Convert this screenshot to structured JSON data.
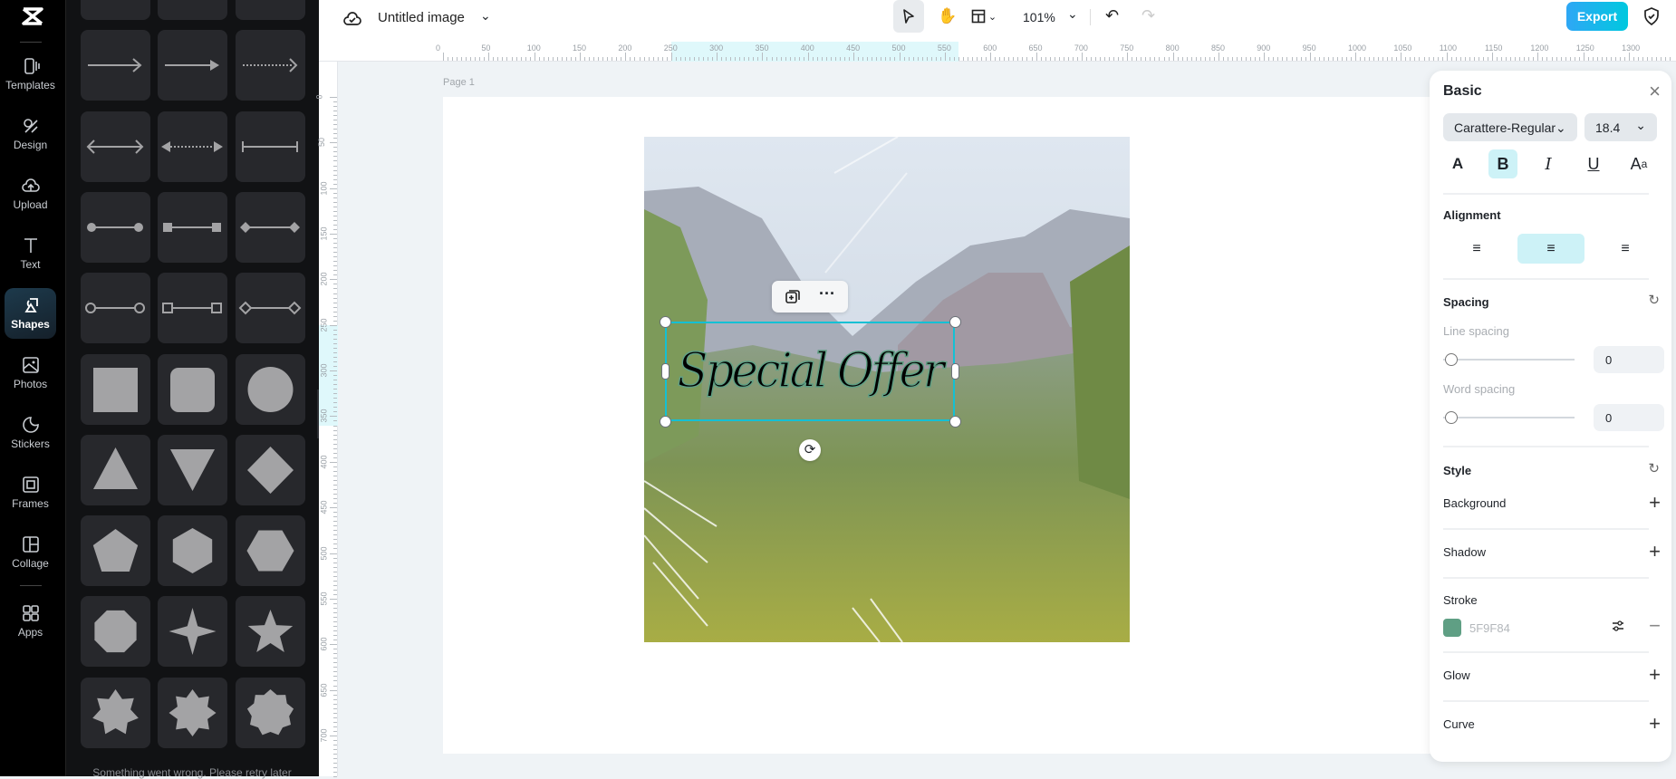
{
  "rail": {
    "items": [
      {
        "label": "Templates",
        "icon": "templates-icon"
      },
      {
        "label": "Design",
        "icon": "design-icon"
      },
      {
        "label": "Upload",
        "icon": "upload-icon"
      },
      {
        "label": "Text",
        "icon": "text-icon"
      },
      {
        "label": "Shapes",
        "icon": "shapes-icon",
        "active": true
      },
      {
        "label": "Photos",
        "icon": "photos-icon"
      },
      {
        "label": "Stickers",
        "icon": "stickers-icon"
      },
      {
        "label": "Frames",
        "icon": "frames-icon"
      },
      {
        "label": "Collage",
        "icon": "collage-icon"
      },
      {
        "label": "Apps",
        "icon": "apps-icon"
      }
    ]
  },
  "shapes_panel": {
    "tiles": [
      "blank",
      "blank",
      "blank",
      "arrow-line",
      "arrow-solid",
      "arrow-dotted",
      "double-arrow",
      "double-arrow-dotted",
      "bracket-line",
      "dot-line",
      "square-line",
      "diamond-line",
      "circle-outline-line",
      "square-outline-line",
      "diamond-outline-line",
      "square",
      "rounded-square",
      "circle",
      "triangle",
      "inverted-triangle",
      "diamond",
      "pentagon",
      "hexagon",
      "hexagon-flat",
      "octagon",
      "four-point-star",
      "five-point-star",
      "seven-point-star",
      "eight-point-star",
      "nine-point-star"
    ],
    "error_message": "Something went wrong. Please retry later"
  },
  "topbar": {
    "title": "Untitled image",
    "zoom": "101%",
    "export_label": "Export"
  },
  "rulers": {
    "h_labels": [
      "0",
      "50",
      "100",
      "150",
      "200",
      "250",
      "300",
      "350",
      "400",
      "450",
      "500",
      "550",
      "600",
      "650",
      "700",
      "750",
      "800",
      "850",
      "900",
      "950",
      "1000",
      "1050",
      "1100",
      "1150",
      "1200",
      "1250",
      "1300"
    ],
    "v_labels": [
      "0",
      "50",
      "100",
      "150",
      "200",
      "250",
      "300",
      "350",
      "400",
      "450",
      "500",
      "550",
      "600",
      "650",
      "700"
    ],
    "highlight_x": [
      250,
      565
    ],
    "highlight_y": [
      250,
      360
    ]
  },
  "canvas": {
    "page_label": "Page 1",
    "text": "Special Offer"
  },
  "right_panel": {
    "title": "Basic",
    "font": "Carattere-Regular",
    "font_size": "18.4",
    "alignment_label": "Alignment",
    "spacing_label": "Spacing",
    "line_spacing_label": "Line spacing",
    "line_spacing": "0",
    "word_spacing_label": "Word spacing",
    "word_spacing": "0",
    "style_label": "Style",
    "background_label": "Background",
    "shadow_label": "Shadow",
    "stroke_label": "Stroke",
    "stroke_color": "5F9F84",
    "stroke_hex": "#5F9F84",
    "glow_label": "Glow",
    "curve_label": "Curve"
  },
  "colors": {
    "accent": "#14c0d4",
    "export_start": "#2fa7f5",
    "export_end": "#00c8df",
    "active_tool": "#cdf2f7"
  }
}
